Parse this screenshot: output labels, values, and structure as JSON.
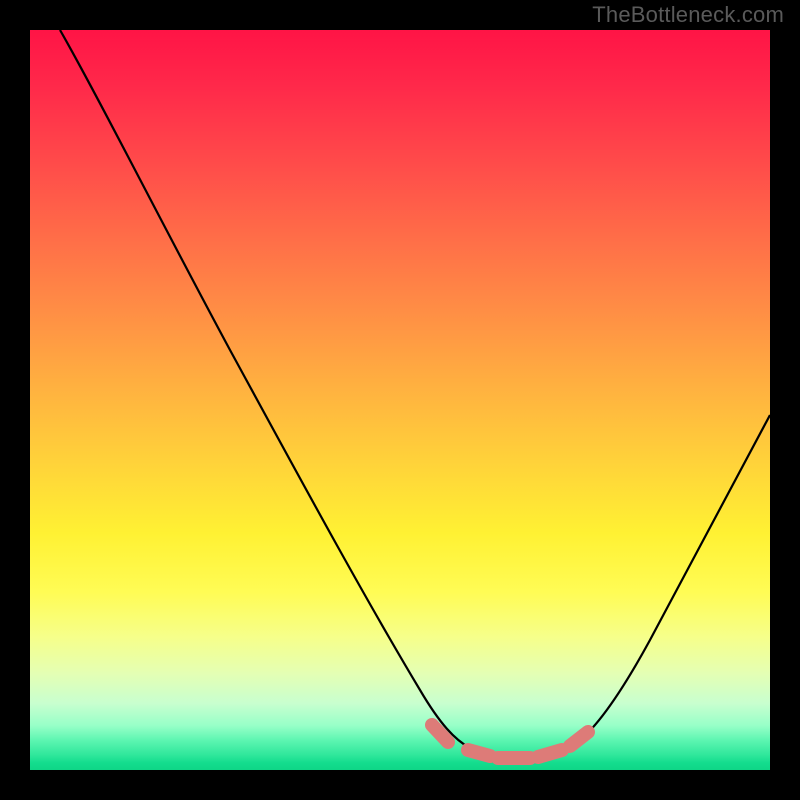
{
  "watermark": "TheBottleneck.com",
  "chart_data": {
    "type": "line",
    "title": "",
    "xlabel": "",
    "ylabel": "",
    "xlim": [
      0,
      100
    ],
    "ylim": [
      0,
      100
    ],
    "grid": false,
    "legend": false,
    "series": [
      {
        "name": "curve",
        "color": "#000000",
        "x": [
          4,
          10,
          20,
          30,
          40,
          50,
          55,
          58,
          60,
          63,
          68,
          72,
          76,
          80,
          85,
          90,
          95,
          100
        ],
        "y": [
          100,
          88,
          70,
          52,
          35,
          17,
          8,
          4,
          2,
          1,
          1,
          2,
          5,
          10,
          18,
          28,
          38,
          48
        ]
      }
    ],
    "highlight": {
      "name": "notch-markers",
      "color": "#dd7b78",
      "points": [
        {
          "x": 55,
          "y": 5
        },
        {
          "x": 60,
          "y": 2
        },
        {
          "x": 64,
          "y": 1
        },
        {
          "x": 68,
          "y": 1
        },
        {
          "x": 72,
          "y": 2
        },
        {
          "x": 76,
          "y": 4
        }
      ]
    },
    "gradient_stops": [
      {
        "pos": 0,
        "color": "#ff1446"
      },
      {
        "pos": 50,
        "color": "#ffd13a"
      },
      {
        "pos": 80,
        "color": "#fffc55"
      },
      {
        "pos": 100,
        "color": "#0fd687"
      }
    ]
  }
}
